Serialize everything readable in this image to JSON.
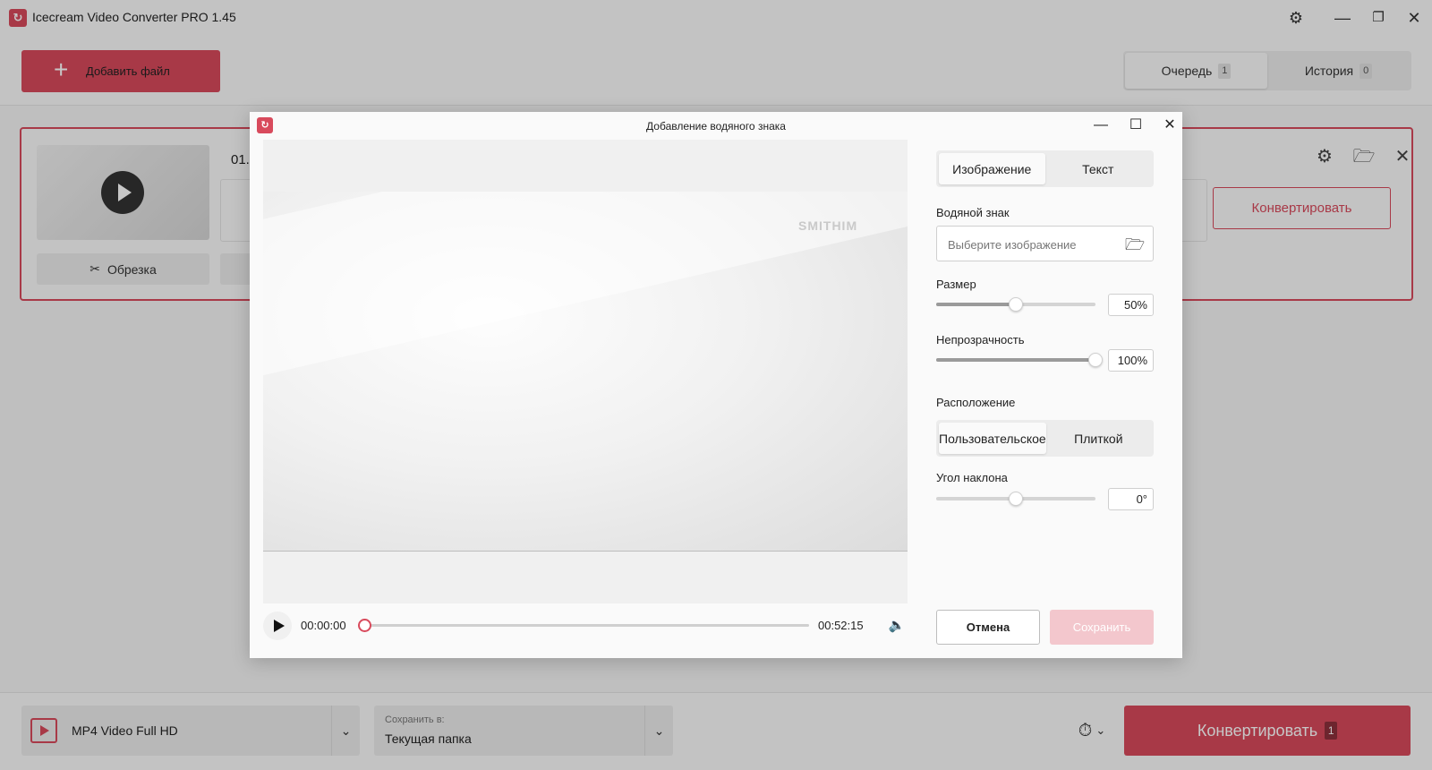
{
  "app": {
    "title": "Icecream Video Converter PRO 1.45",
    "window_controls": {
      "settings": "⚙",
      "minimize": "—",
      "restore": "❐",
      "close": "✕"
    }
  },
  "toolbar": {
    "add_file_label": "Добавить файл",
    "add_icon": "+",
    "tabs": [
      {
        "label": "Очередь",
        "count": "1",
        "active": true
      },
      {
        "label": "История",
        "count": "0",
        "active": false
      }
    ]
  },
  "file_card": {
    "file_name": "01.",
    "trim_label": "Обрезка",
    "convert_label": "Конвертировать",
    "icons": {
      "settings": "⚙",
      "folder": "🗁",
      "close": "✕"
    }
  },
  "bottombar": {
    "format_label": "MP4 Video Full HD",
    "save_caption": "Сохранить в:",
    "save_value": "Текущая папка",
    "convert_label": "Конвертировать",
    "convert_count": "1",
    "chevron": "⌄",
    "timer_icon": "⏱"
  },
  "modal": {
    "title": "Добавление водяного знака",
    "window_controls": {
      "minimize": "—",
      "maximize": "☐",
      "close": "✕"
    },
    "preview": {
      "watermark_text": "SMITHIM"
    },
    "player": {
      "current_time": "00:00:00",
      "total_time": "00:52:15",
      "progress": 0,
      "volume_icon": "🔈"
    },
    "tabs": [
      {
        "label": "Изображение",
        "active": true
      },
      {
        "label": "Текст",
        "active": false
      }
    ],
    "watermark_label": "Водяной знак",
    "watermark_placeholder": "Выберите изображение",
    "size_label": "Размер",
    "size_value": "50%",
    "size_level": 0.5,
    "opacity_label": "Непрозрачность",
    "opacity_value": "100%",
    "opacity_level": 1.0,
    "position_label": "Расположение",
    "position_tabs": [
      {
        "label": "Пользовательское",
        "active": true
      },
      {
        "label": "Плиткой",
        "active": false
      }
    ],
    "angle_label": "Угол наклона",
    "angle_value": "0°",
    "angle_level": 0.5,
    "cancel_label": "Отмена",
    "save_label": "Сохранить"
  },
  "colors": {
    "accent": "#d84a5c",
    "accent_disabled": "#f3c7cd"
  }
}
